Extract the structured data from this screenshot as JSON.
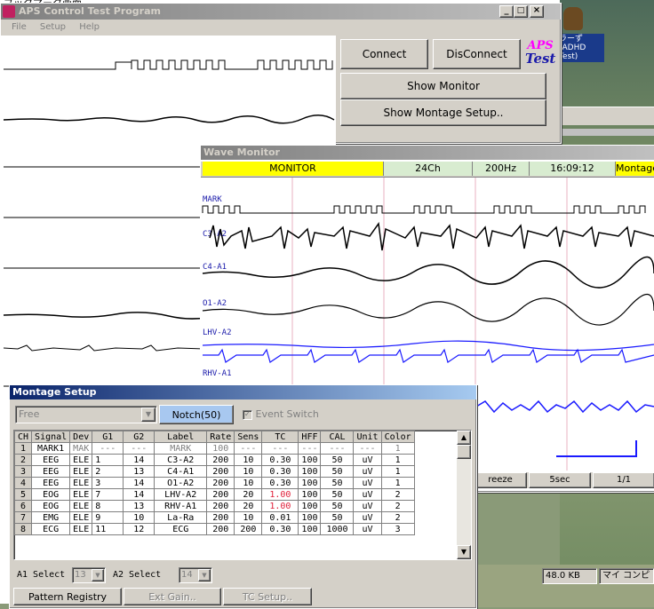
{
  "desktop": {
    "top_fragment": "ブックマーク画面",
    "icon_label_1": "ラーず(ADHD",
    "icon_label_2": "Test)",
    "status_size": "48.0 KB",
    "status_right": "マイ コンピ"
  },
  "main_window": {
    "title": "APS Control Test Program",
    "menu": [
      "File",
      "Setup",
      "Help"
    ],
    "connect_label": "Connect",
    "disconnect_label": "DisConnect",
    "logo_line1": "APS",
    "logo_line2": "Test",
    "show_monitor_label": "Show Monitor",
    "show_montage_label": "Show Montage Setup.."
  },
  "wave_monitor": {
    "title": "Wave Monitor",
    "header": {
      "mode": "MONITOR",
      "channels": "24Ch",
      "rate": "200Hz",
      "time": "16:09:12",
      "montage": "Montage"
    },
    "channel_labels": [
      "MARK",
      "C3-A2",
      "C4-A1",
      "O1-A2",
      "LHV-A2",
      "RHV-A1"
    ],
    "bottom": {
      "freeze": "reeze",
      "duration": "5sec",
      "page": "1/1"
    }
  },
  "montage_setup": {
    "title": "Montage Setup",
    "preset_value": "Free",
    "notch_label": "Notch(50)",
    "event_switch_label": "Event Switch",
    "columns": [
      "CH",
      "Signal",
      "Dev",
      "G1",
      "G2",
      "Label",
      "Rate",
      "Sens",
      "TC",
      "HFF",
      "CAL",
      "Unit",
      "Color"
    ],
    "rows": [
      [
        "1",
        "MARK1",
        "MAK",
        "---",
        "---",
        "MARK",
        "100",
        "---",
        "---",
        "---",
        "---",
        "---",
        "1"
      ],
      [
        "2",
        "EEG",
        "ELE",
        "1",
        "14",
        "C3-A2",
        "200",
        "10",
        "0.30",
        "100",
        "50",
        "uV",
        "1"
      ],
      [
        "3",
        "EEG",
        "ELE",
        "2",
        "13",
        "C4-A1",
        "200",
        "10",
        "0.30",
        "100",
        "50",
        "uV",
        "1"
      ],
      [
        "4",
        "EEG",
        "ELE",
        "3",
        "14",
        "O1-A2",
        "200",
        "10",
        "0.30",
        "100",
        "50",
        "uV",
        "1"
      ],
      [
        "5",
        "EOG",
        "ELE",
        "7",
        "14",
        "LHV-A2",
        "200",
        "20",
        "1.00",
        "100",
        "50",
        "uV",
        "2"
      ],
      [
        "6",
        "EOG",
        "ELE",
        "8",
        "13",
        "RHV-A1",
        "200",
        "20",
        "1.00",
        "100",
        "50",
        "uV",
        "2"
      ],
      [
        "7",
        "EMG",
        "ELE",
        "9",
        "10",
        "La-Ra",
        "200",
        "10",
        "0.01",
        "100",
        "50",
        "uV",
        "2"
      ],
      [
        "8",
        "ECG",
        "ELE",
        "11",
        "12",
        "ECG",
        "200",
        "200",
        "0.30",
        "100",
        "1000",
        "uV",
        "3"
      ]
    ],
    "a1_label": "A1 Select",
    "a1_value": "13",
    "a2_label": "A2 Select",
    "a2_value": "14",
    "pattern_registry_label": "Pattern Registry",
    "ext_gain_label": "Ext Gain..",
    "tc_setup_label": "TC Setup.."
  },
  "colors": {
    "active_title": "#0a246a",
    "inactive_title": "#808080",
    "monitor_yellow": "#ffff00",
    "header_green": "#d8ecd0",
    "notch_blue": "#a8c8f0",
    "eog_blue": "#1a1aff",
    "tc_red": "#e0203a"
  }
}
